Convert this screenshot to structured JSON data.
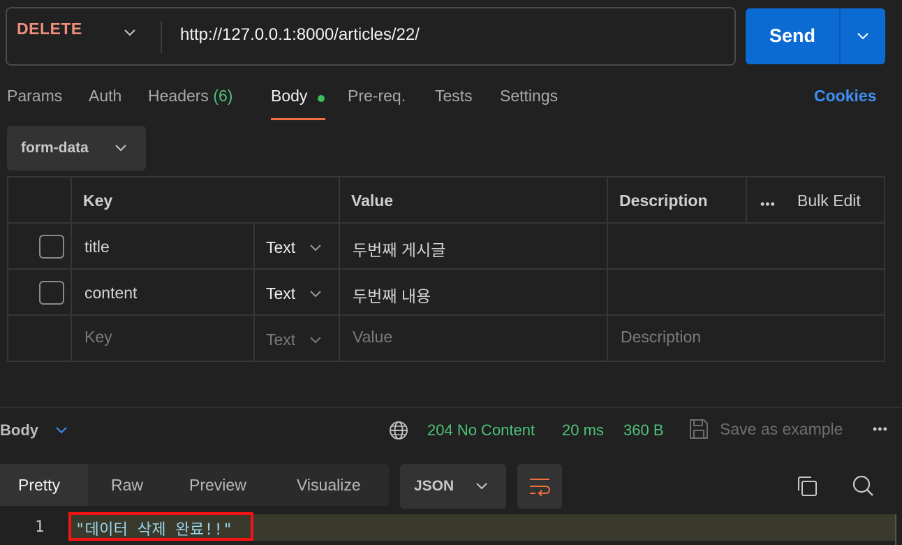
{
  "request": {
    "method": "DELETE",
    "url": "http://127.0.0.1:8000/articles/22/",
    "send_label": "Send"
  },
  "tabs": [
    {
      "label": "Params"
    },
    {
      "label": "Auth"
    },
    {
      "label": "Headers",
      "count": "(6)"
    },
    {
      "label": "Body",
      "active": true
    },
    {
      "label": "Pre-req."
    },
    {
      "label": "Tests"
    },
    {
      "label": "Settings"
    }
  ],
  "cookies_label": "Cookies",
  "body_mode": "form-data",
  "table": {
    "headers": {
      "key": "Key",
      "value": "Value",
      "description": "Description"
    },
    "bulk_edit": "Bulk Edit",
    "more": "•••",
    "rows": [
      {
        "key": "title",
        "type": "Text",
        "value": "두번째 게시글",
        "description": ""
      },
      {
        "key": "content",
        "type": "Text",
        "value": "두번째 내용",
        "description": ""
      }
    ],
    "placeholder": {
      "key": "Key",
      "type": "Text",
      "value": "Value",
      "description": "Description"
    }
  },
  "response": {
    "section_label": "Body",
    "status": "204 No Content",
    "time": "20 ms",
    "size": "360 B",
    "save_example": "Save as example",
    "more": "•••",
    "view_tabs": [
      "Pretty",
      "Raw",
      "Preview",
      "Visualize"
    ],
    "active_view": "Pretty",
    "format": "JSON",
    "lines": [
      {
        "number": "1",
        "text": "\"데이터 삭제 완료!!\""
      }
    ]
  },
  "colors": {
    "method": "#f08f7e",
    "send": "#0b6bd3",
    "status": "#4ec27a",
    "cookies": "#3d8ff0",
    "tab_underline": "#f2703f",
    "highlight_box": "#f01414"
  }
}
